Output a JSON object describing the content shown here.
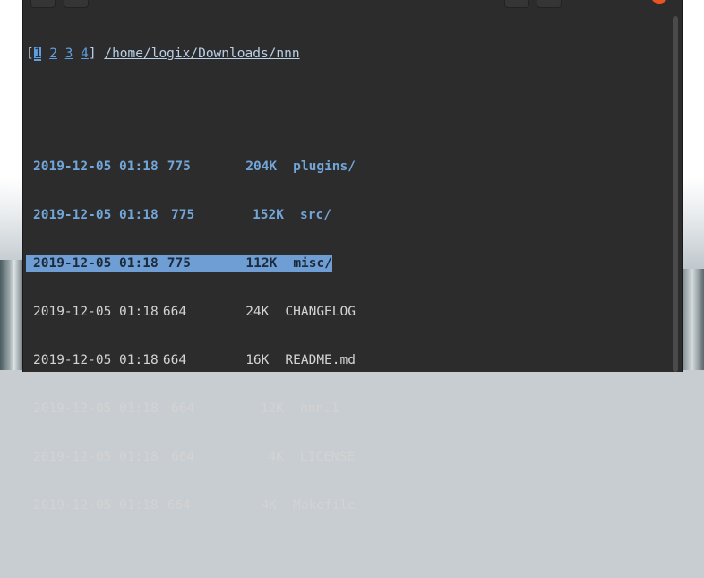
{
  "app": {
    "name": "nnn",
    "accent_color": "#5f9ee0",
    "selection_color": "#6f9ed4",
    "background_color": "#2c2c2c"
  },
  "tabs": {
    "open_bracket": "[",
    "close_bracket": "]",
    "items": [
      "1",
      "2",
      "3",
      "4"
    ],
    "active_index": 0
  },
  "path": "/home/logix/Downloads/nnn",
  "entries": [
    {
      "date": "2019-12-05 01:18",
      "perm": "775",
      "size": "204K",
      "name": "plugins/",
      "type": "dir"
    },
    {
      "date": "2019-12-05 01:18",
      "perm": "775",
      "size": "152K",
      "name": "src/",
      "type": "dir"
    },
    {
      "date": "2019-12-05 01:18",
      "perm": "775",
      "size": "112K",
      "name": "misc/",
      "type": "dir",
      "selected": true
    },
    {
      "date": "2019-12-05 01:18",
      "perm": "664",
      "size": "24K",
      "name": "CHANGELOG",
      "type": "file"
    },
    {
      "date": "2019-12-05 01:18",
      "perm": "664",
      "size": "16K",
      "name": "README.md",
      "type": "file"
    },
    {
      "date": "2019-12-05 01:18",
      "perm": "664",
      "size": "12K",
      "name": "nnn.1",
      "type": "file"
    },
    {
      "date": "2019-12-05 01:18",
      "perm": "664",
      "size": "4K",
      "name": "LICENSE",
      "type": "file"
    },
    {
      "date": "2019-12-05 01:18",
      "perm": "664",
      "size": "4K",
      "name": "Makefile",
      "type": "file"
    }
  ]
}
